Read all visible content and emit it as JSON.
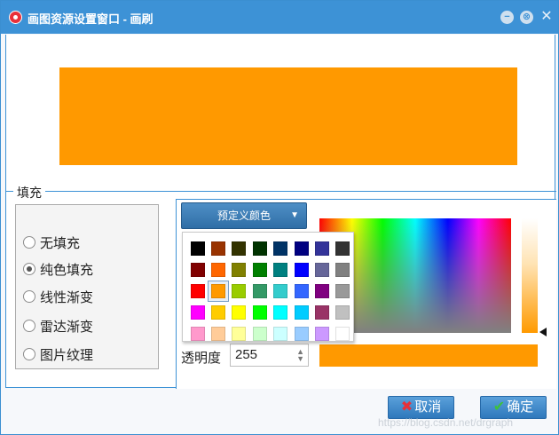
{
  "window": {
    "title": "画图资源设置窗口 - 画刷",
    "icon": "app-icon"
  },
  "preview": {
    "color": "#ff9900"
  },
  "fill": {
    "legend": "填充",
    "options": [
      {
        "label": "无填充",
        "selected": false
      },
      {
        "label": "纯色填充",
        "selected": true
      },
      {
        "label": "线性渐变",
        "selected": false
      },
      {
        "label": "雷达渐变",
        "selected": false
      },
      {
        "label": "图片纹理",
        "selected": false
      }
    ]
  },
  "color_picker": {
    "preset_label": "预定义颜色",
    "selected_color": "#ff9900",
    "alpha_label": "透明度",
    "alpha_value": "255",
    "palette": [
      [
        "#000000",
        "#993300",
        "#333300",
        "#003300",
        "#003366",
        "#000080",
        "#333399",
        "#333333"
      ],
      [
        "#800000",
        "#ff6600",
        "#808000",
        "#008000",
        "#008080",
        "#0000ff",
        "#666699",
        "#808080"
      ],
      [
        "#ff0000",
        "#ff9900",
        "#99cc00",
        "#339966",
        "#33cccc",
        "#3366ff",
        "#800080",
        "#999999"
      ],
      [
        "#ff00ff",
        "#ffcc00",
        "#ffff00",
        "#00ff00",
        "#00ffff",
        "#00ccff",
        "#993366",
        "#c0c0c0"
      ],
      [
        "#ff99cc",
        "#ffcc99",
        "#ffff99",
        "#ccffcc",
        "#ccffff",
        "#99ccff",
        "#cc99ff",
        "#ffffff"
      ]
    ]
  },
  "buttons": {
    "cancel": "取消",
    "ok": "确定"
  },
  "watermark": "https://blog.csdn.net/drgraph"
}
